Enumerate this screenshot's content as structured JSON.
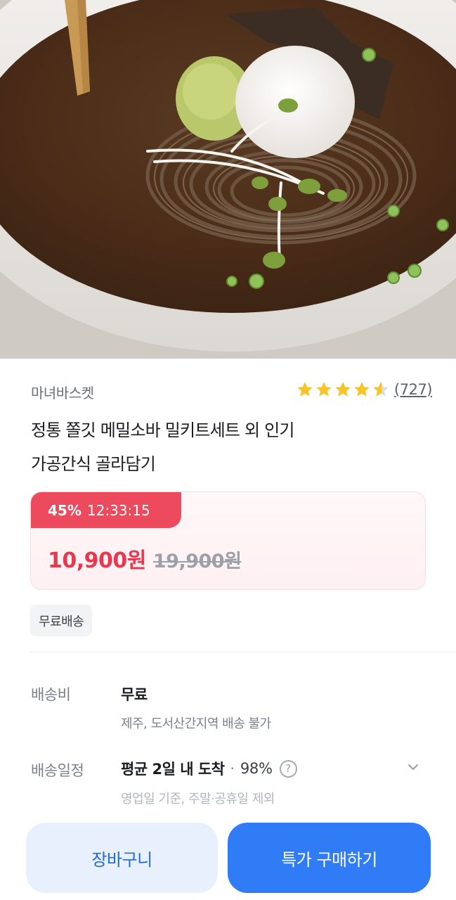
{
  "product": {
    "image_alt": "",
    "seller": "마녀바스켓",
    "rating": 4.5,
    "review_count": "(727)",
    "title_line1": "정통 쫄깃 메밀소바 밀키트세트 외 인기",
    "title_line2": "가공간식 골라담기"
  },
  "price": {
    "discount": "45%",
    "timer": "12:33:15",
    "sale_price": "10,900원",
    "original_price": "19,900원"
  },
  "tags": [
    "무료배송"
  ],
  "shipping": {
    "fee_label": "배송비",
    "fee_value": "무료",
    "fee_note": "제주, 도서산간지역 배송 불가",
    "schedule_label": "배송일정",
    "schedule_value": "평균 2일 내 도착",
    "schedule_rate": "98%",
    "schedule_note": "영업일 기준, 주말·공휴일 제외"
  },
  "actions": {
    "cart_label": "장바구니",
    "buy_label": "특가 구매하기"
  },
  "colors": {
    "accent_red": "#e8384f",
    "badge_red": "#ee4a5e",
    "primary_blue": "#2f7cf6",
    "star_yellow": "#f7c325"
  }
}
